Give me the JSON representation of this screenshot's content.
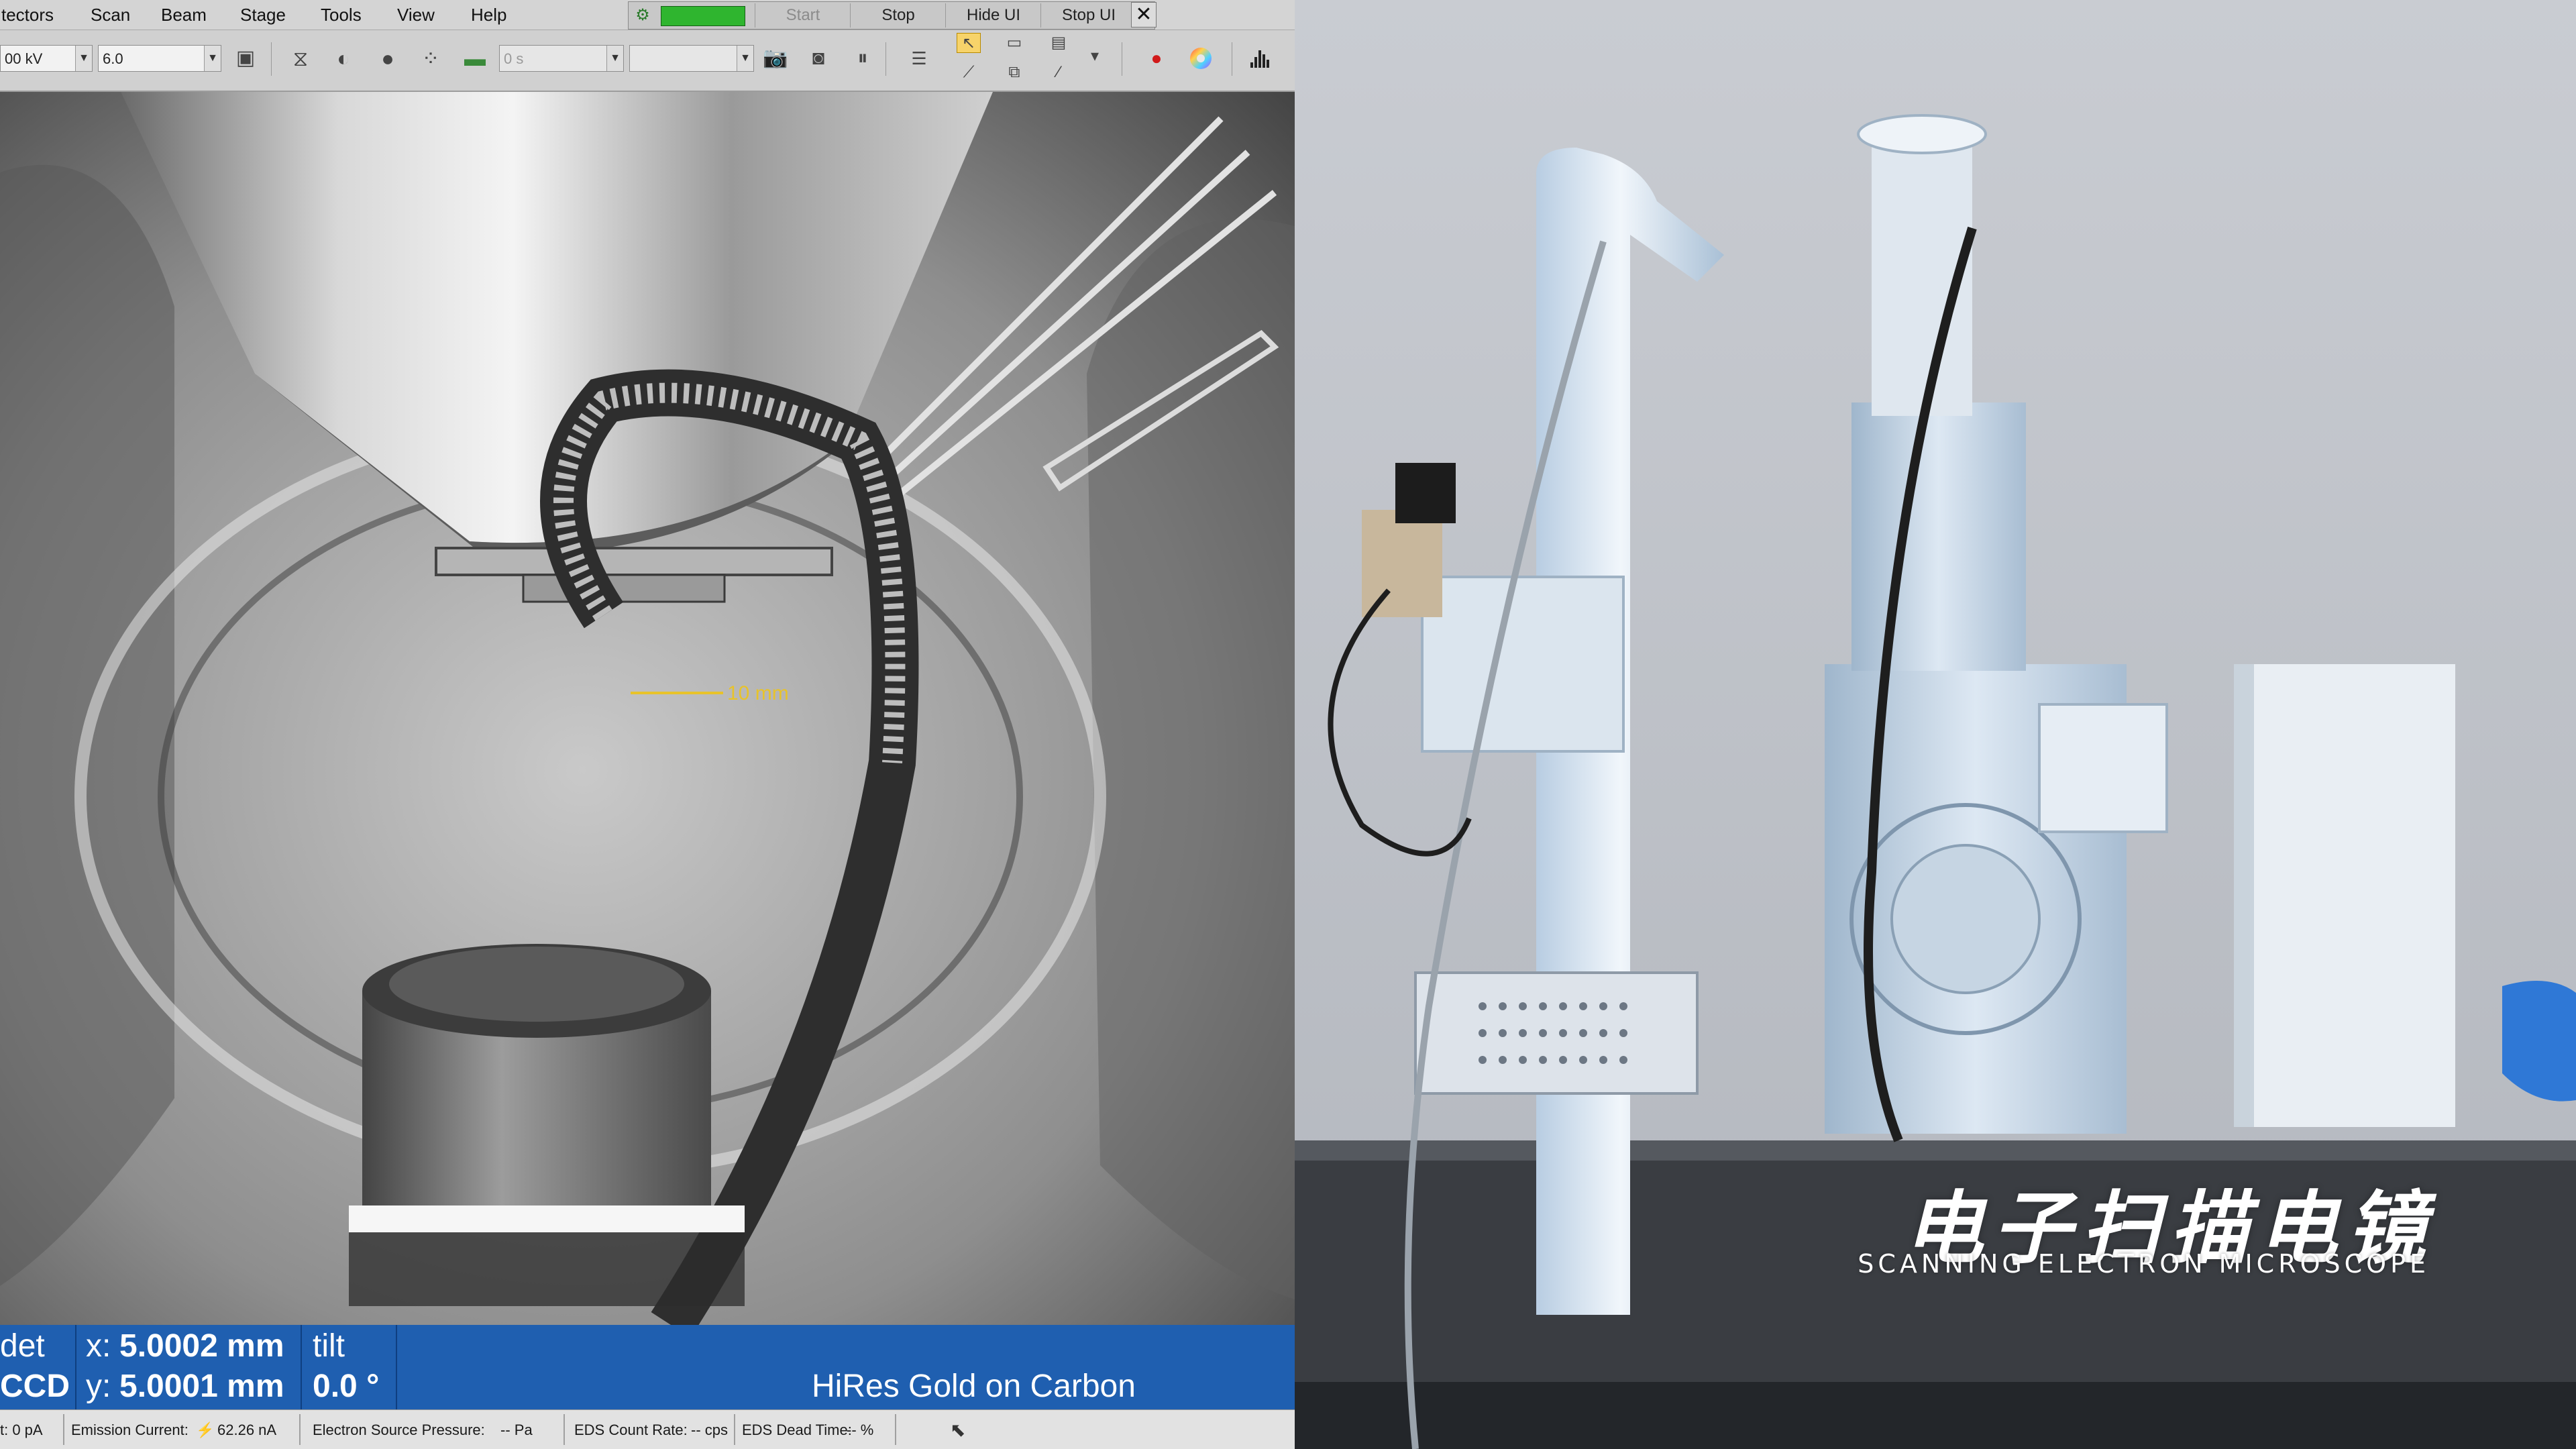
{
  "menubar": {
    "items": [
      "tectors",
      "Scan",
      "Beam",
      "Stage",
      "Tools",
      "View",
      "Help"
    ],
    "controls": {
      "start": "Start",
      "stop": "Stop",
      "hide_ui": "Hide UI",
      "stop_ui": "Stop UI",
      "close": "✕"
    },
    "run_state_color": "#2fb52f"
  },
  "toolbar": {
    "voltage": "00 kV",
    "spot": "6.0",
    "dwell": "0 s",
    "blank_combo": "",
    "icons": [
      "select-area-icon",
      "contrast-icon",
      "brightness-icon",
      "auto-focus-icon",
      "image-icon",
      "camera-icon",
      "snapshot-icon",
      "pause-icon",
      "scan-mode-icon",
      "pointer-icon",
      "measure-icon",
      "record-icon",
      "color-wheel-icon",
      "histogram-icon"
    ]
  },
  "viewer": {
    "scale_bar_label": "10 mm",
    "scale_color": "#e8c32a"
  },
  "infobar": {
    "detector_label": "det",
    "detector_value": "CCD",
    "x_label": "x:",
    "x_value": "5.0002 mm",
    "y_label": "y:",
    "y_value": "5.0001 mm",
    "tilt_label": "tilt",
    "tilt_value": "0.0 °",
    "sample": "HiRes Gold on Carbon",
    "color": "#1f5fb0"
  },
  "statusbar": {
    "beam_current": "t: 0 pA",
    "emission_label": "Emission Current:",
    "emission_value": "62.26 nA",
    "pressure_label": "Electron Source Pressure:",
    "pressure_value": "-- Pa",
    "eds_count_label": "EDS Count Rate:",
    "eds_count_value": "-- cps",
    "eds_dead_label": "EDS Dead Time:",
    "eds_dead_value": "-- %"
  },
  "video": {
    "title_cn": "电子扫描电镜",
    "title_en": "SCANNING ELECTRON MICROSCOPE"
  }
}
